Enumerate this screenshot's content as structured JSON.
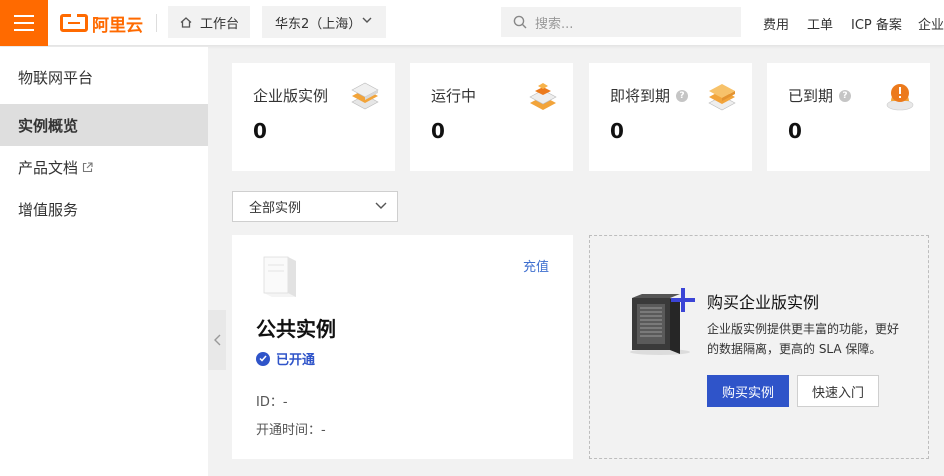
{
  "header": {
    "menu_icon": "hamburger-icon",
    "brand": "阿里云",
    "workbench": "工作台",
    "region": "华东2（上海）",
    "search_placeholder": "搜索...",
    "nav": [
      "费用",
      "工单",
      "ICP 备案",
      "企业"
    ]
  },
  "sidebar": {
    "title": "物联网平台",
    "items": [
      {
        "label": "实例概览",
        "active": true
      },
      {
        "label": "产品文档",
        "external": true
      },
      {
        "label": "增值服务"
      }
    ]
  },
  "stats": [
    {
      "label": "企业版实例",
      "value": "0",
      "icon": "stack-icon"
    },
    {
      "label": "运行中",
      "value": "0",
      "icon": "running-stack-icon"
    },
    {
      "label": "即将到期",
      "value": "0",
      "icon": "expiring-stack-icon",
      "help": true
    },
    {
      "label": "已到期",
      "value": "0",
      "icon": "expired-alert-icon",
      "help": true
    }
  ],
  "filter": {
    "value": "全部实例"
  },
  "public_instance": {
    "title": "公共实例",
    "recharge": "充值",
    "status": "已开通",
    "id_label": "ID：-",
    "opened_label": "开通时间：-"
  },
  "enterprise_promo": {
    "title": "购买企业版实例",
    "description": "企业版实例提供更丰富的功能，更好的数据隔离，更高的 SLA 保障。",
    "buy_button": "购买实例",
    "quick_button": "快速入门"
  },
  "colors": {
    "brand_orange": "#ff6a00",
    "primary_blue": "#2f54c9",
    "link_blue": "#3f6fcf"
  }
}
